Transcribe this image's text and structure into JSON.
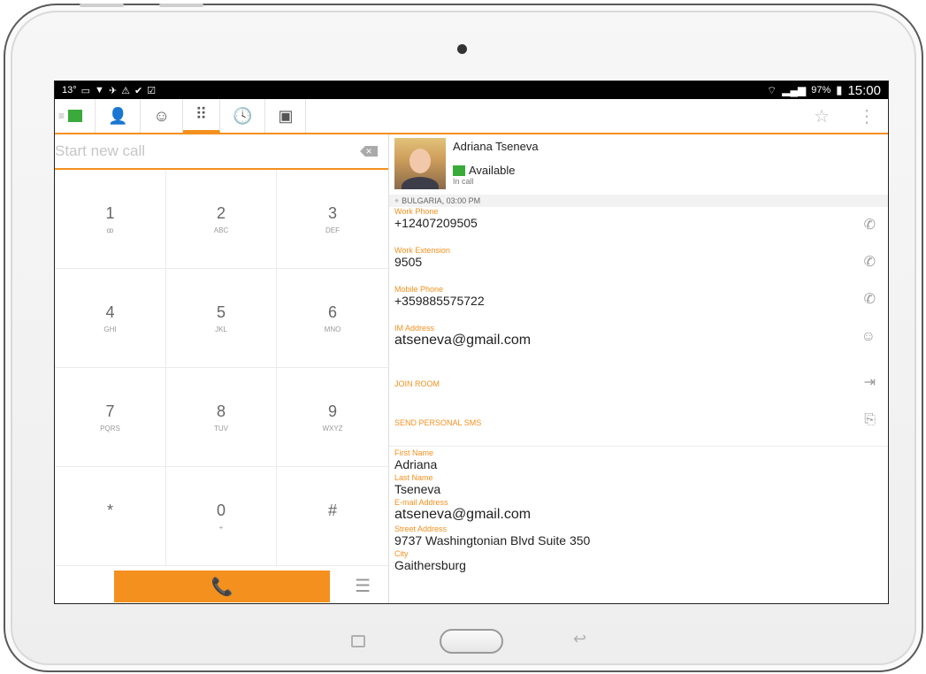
{
  "status_bar": {
    "left": [
      "13°",
      "▭",
      "▼",
      "✈",
      "⚠",
      "✔",
      "☑"
    ],
    "battery": "97%",
    "time": "15:00"
  },
  "toolbar": {
    "tabs": [
      {
        "icon": "flag-icon"
      },
      {
        "icon": "contacts-icon",
        "glyph": "👤"
      },
      {
        "icon": "chat-icon",
        "glyph": "☺"
      },
      {
        "icon": "dialpad-icon",
        "glyph": "⠿"
      },
      {
        "icon": "history-icon",
        "glyph": "🕓"
      },
      {
        "icon": "voicemail-icon",
        "glyph": "▣"
      }
    ],
    "favorite_glyph": "☆",
    "overflow_glyph": "⋮"
  },
  "dialer": {
    "placeholder": "Start new call",
    "backspace_glyph": "✕",
    "keys": [
      {
        "digit": "1",
        "letters": "ꝏ"
      },
      {
        "digit": "2",
        "letters": "ABC"
      },
      {
        "digit": "3",
        "letters": "DEF"
      },
      {
        "digit": "4",
        "letters": "GHI"
      },
      {
        "digit": "5",
        "letters": "JKL"
      },
      {
        "digit": "6",
        "letters": "MNO"
      },
      {
        "digit": "7",
        "letters": "PQRS"
      },
      {
        "digit": "8",
        "letters": "TUV"
      },
      {
        "digit": "9",
        "letters": "WXYZ"
      },
      {
        "digit": "*",
        "letters": ""
      },
      {
        "digit": "0",
        "letters": "+"
      },
      {
        "digit": "#",
        "letters": ""
      }
    ],
    "call_glyph": "📞",
    "history_glyph": "☰"
  },
  "contact": {
    "name": "Adriana Tseneva",
    "presence": "Available",
    "substatus": "In call",
    "location": "BULGARIA, 03:00 PM",
    "phones": [
      {
        "label": "Work Phone",
        "value": "+12407209505"
      },
      {
        "label": "Work Extension",
        "value": "9505"
      },
      {
        "label": "Mobile Phone",
        "value": "+359885575722"
      }
    ],
    "im": {
      "label": "IM Address",
      "value": "atseneva@gmail.com"
    },
    "actions": [
      "JOIN ROOM",
      "SEND PERSONAL SMS"
    ],
    "info": [
      {
        "label": "First Name",
        "value": "Adriana"
      },
      {
        "label": "Last Name",
        "value": "Tseneva"
      },
      {
        "label": "E-mail Address",
        "value": "atseneva@gmail.com"
      },
      {
        "label": "Street Address",
        "value": "9737 Washingtonian Blvd Suite 350"
      },
      {
        "label": "City",
        "value": "Gaithersburg"
      }
    ]
  },
  "colors": {
    "accent": "#f4901e",
    "available": "#3aaa3a"
  }
}
